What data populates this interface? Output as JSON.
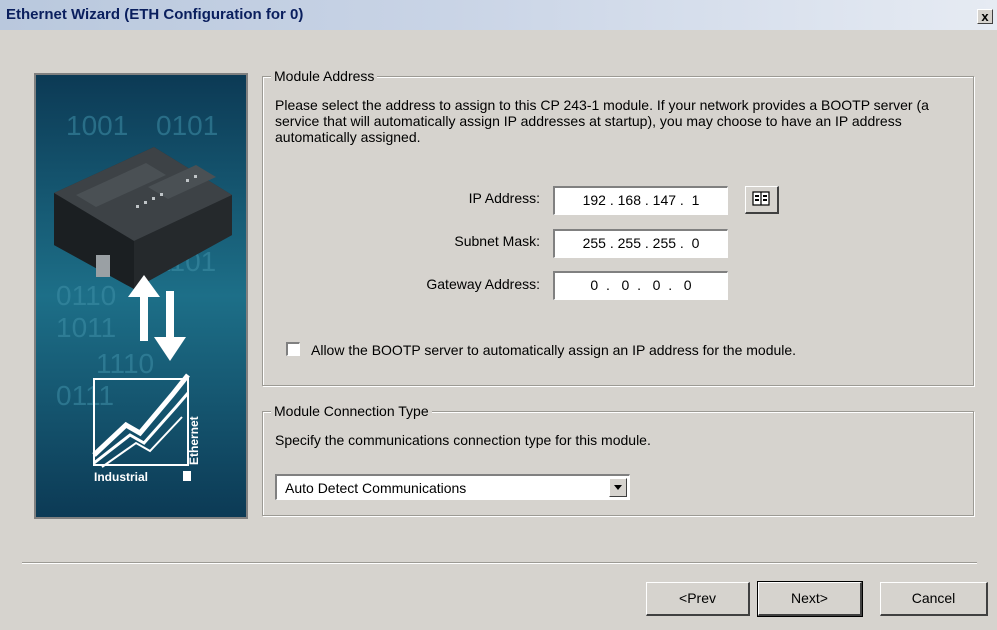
{
  "window": {
    "title": "Ethernet Wizard (ETH Configuration for 0)",
    "close_glyph": "x"
  },
  "side_image": {
    "binary_text_rows": [
      "1001",
      "0101",
      "1101",
      "0110",
      "1011",
      "1110",
      "0111"
    ],
    "logo_text_1": "Industrial",
    "logo_text_2": "Ethernet"
  },
  "module_address": {
    "legend": "Module Address",
    "description": "Please select the address to assign to this CP 243-1  module. If your network provides a BOOTP server (a service that will automatically assign IP addresses at startup), you may choose to have an IP address automatically assigned.",
    "ip_label": "IP Address:",
    "ip_value": "192 . 168 . 147 .  1",
    "subnet_label": "Subnet Mask:",
    "subnet_value": "255 . 255 . 255 .  0",
    "gateway_label": "Gateway Address:",
    "gateway_value": "0  .   0  .   0  .   0",
    "bootp_label": "Allow the BOOTP server to automatically assign an IP address for the module.",
    "bootp_checked": false
  },
  "connection_type": {
    "legend": "Module Connection Type",
    "description": "Specify the communications connection type for this module.",
    "selected": "Auto Detect Communications"
  },
  "buttons": {
    "prev": "<Prev",
    "next": "Next>",
    "cancel": "Cancel"
  },
  "colors": {
    "dialog_bg": "#d6d3ce",
    "title_text": "#0a1f5e",
    "image_bg": "#0f3f55"
  }
}
